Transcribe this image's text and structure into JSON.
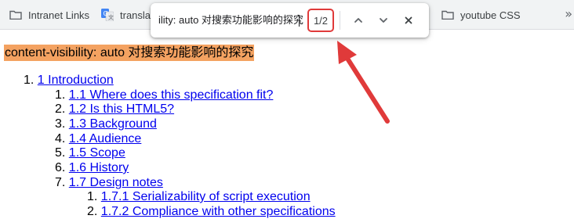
{
  "bookmarks": {
    "items": [
      {
        "label": "Intranet Links",
        "icon": "folder-icon"
      },
      {
        "label": "transla",
        "icon": "google-translate-icon"
      },
      {
        "label": "youtube CSS",
        "icon": "folder-icon"
      }
    ],
    "overflow": "»"
  },
  "findbar": {
    "query": "ility: auto 对搜索功能影响的探究",
    "match_count": "1/2",
    "prev_icon": "chevron-up-icon",
    "next_icon": "chevron-down-icon",
    "close_icon": "close-icon"
  },
  "page": {
    "title": "content-visibility: auto 对搜索功能影响的探究",
    "highlight_color": "#f4a261",
    "toc": [
      {
        "num": "1.",
        "label": "1 Introduction"
      },
      {
        "num": "1.",
        "label": "1.1 Where does this specification fit?"
      },
      {
        "num": "2.",
        "label": "1.2 Is this HTML5?"
      },
      {
        "num": "3.",
        "label": "1.3 Background"
      },
      {
        "num": "4.",
        "label": "1.4 Audience"
      },
      {
        "num": "5.",
        "label": "1.5 Scope"
      },
      {
        "num": "6.",
        "label": "1.6 History"
      },
      {
        "num": "7.",
        "label": "1.7 Design notes"
      },
      {
        "num": "1.",
        "label": "1.7.1 Serializability of script execution"
      },
      {
        "num": "2.",
        "label": "1.7.2 Compliance with other specifications"
      }
    ]
  },
  "annotation": {
    "arrow_color": "#e03a3a"
  }
}
